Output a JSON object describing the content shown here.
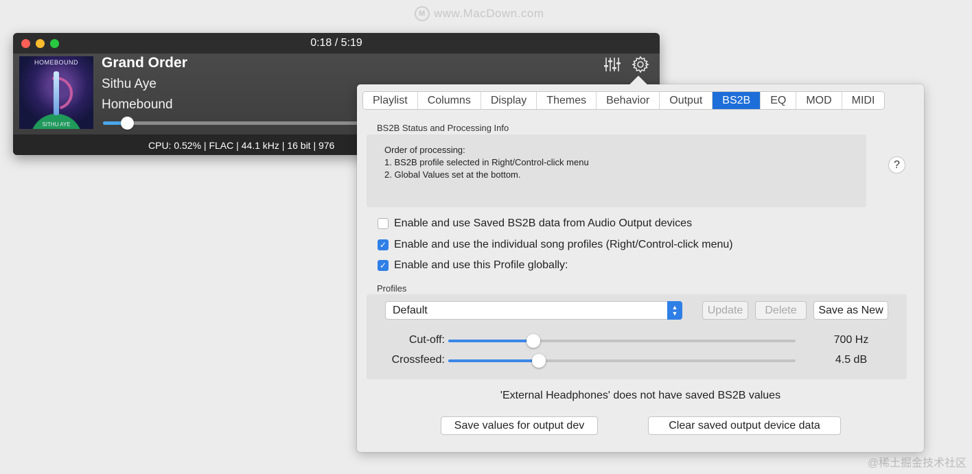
{
  "watermark": {
    "site": "www.MacDown.com",
    "corner": "@稀土掘金技术社区"
  },
  "player": {
    "time": "0:18 / 5:19",
    "album_art": {
      "title": "HOMEBOUND",
      "artist": "SITHU AYE"
    },
    "track_title": "Grand Order",
    "artist": "Sithu Aye",
    "album": "Homebound",
    "seek_progress": 0.094,
    "status": "CPU: 0.52% | FLAC | 44.1 kHz | 16 bit | 976",
    "icons": [
      "equalizer-icon",
      "gear-icon"
    ]
  },
  "prefs": {
    "tabs": [
      {
        "label": "Playlist",
        "active": false
      },
      {
        "label": "Columns",
        "active": false
      },
      {
        "label": "Display",
        "active": false
      },
      {
        "label": "Themes",
        "active": false
      },
      {
        "label": "Behavior",
        "active": false
      },
      {
        "label": "Output",
        "active": false
      },
      {
        "label": "BS2B",
        "active": true
      },
      {
        "label": "EQ",
        "active": false
      },
      {
        "label": "MOD",
        "active": false
      },
      {
        "label": "MIDI",
        "active": false
      }
    ],
    "status_title": "BS2B Status and Processing Info",
    "info_lines": [
      "Order of processing:",
      "1. BS2B profile selected in Right/Control-click menu",
      "2. Global Values set at the bottom."
    ],
    "help_label": "?",
    "checkboxes": [
      {
        "label": "Enable and use Saved BS2B data from Audio Output devices",
        "checked": false
      },
      {
        "label": "Enable and use the individual song profiles (Right/Control-click menu)",
        "checked": true
      },
      {
        "label": "Enable and use this Profile globally:",
        "checked": true
      }
    ],
    "profiles_title": "Profiles",
    "profile_selected": "Default",
    "update_label": "Update",
    "delete_label": "Delete",
    "save_new_label": "Save as New",
    "cutoff_label": "Cut-off:",
    "cutoff_value": "700 Hz",
    "cutoff_fraction": 0.245,
    "crossfeed_label": "Crossfeed:",
    "crossfeed_value": "4.5 dB",
    "crossfeed_fraction": 0.26,
    "notice": "'External Headphones' does not have saved BS2B values",
    "save_values_label": "Save values for output dev",
    "clear_saved_label": "Clear saved output device data"
  }
}
